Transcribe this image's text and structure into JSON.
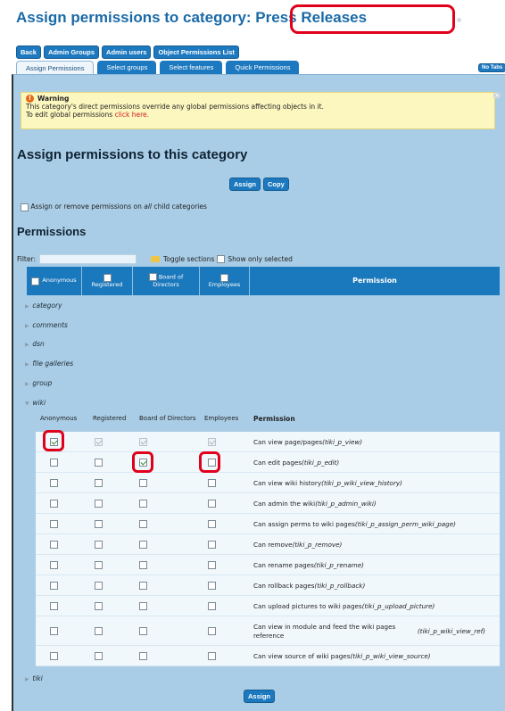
{
  "page": {
    "title_prefix": "Assign permissions to category",
    "title_category": ": Press Releases"
  },
  "nav_buttons": [
    "Back",
    "Admin Groups",
    "Admin users",
    "Object Permissions List"
  ],
  "tabs": [
    "Assign Permissions",
    "Select groups",
    "Select features",
    "Quick Permissions"
  ],
  "no_tabs_label": "No Tabs",
  "warning": {
    "heading": "Warning",
    "line1": "This category's direct permissions override any global permissions affecting objects in it.",
    "line2_prefix": "To edit global permissions",
    "link_text": "click here."
  },
  "section_heading": "Assign permissions to this category",
  "buttons": {
    "assign": "Assign",
    "copy": "Copy"
  },
  "child_categories": {
    "prefix": "Assign or remove permissions on",
    "emphasis": "all",
    "suffix": "child categories"
  },
  "permissions_heading": "Permissions",
  "filter": {
    "label": "Filter:",
    "toggle_sections": "Toggle sections",
    "show_only_selected": "Show only selected"
  },
  "group_header": [
    {
      "line1": "Anonymous",
      "line2": ""
    },
    {
      "line1": "",
      "line2": "Registered"
    },
    {
      "line1": "Board of",
      "line2": "Directors"
    },
    {
      "line1": "",
      "line2": "Employees"
    }
  ],
  "permission_header": "Permission",
  "sections": [
    "category",
    "comments",
    "dsn",
    "file galleries",
    "group",
    "wiki",
    "tiki"
  ],
  "wiki_columns": [
    "Anonymous",
    "Registered",
    "Board of Directors",
    "Employees",
    "Permission"
  ],
  "wiki_permissions": [
    {
      "label": "Can view page/pages",
      "code": "(tiki_p_view)",
      "checked": [
        true,
        true,
        true,
        true
      ],
      "disabled": [
        false,
        true,
        true,
        true
      ]
    },
    {
      "label": "Can edit pages",
      "code": "(tiki_p_edit)",
      "checked": [
        false,
        false,
        true,
        false
      ],
      "disabled": [
        false,
        false,
        false,
        false
      ]
    },
    {
      "label": "Can view wiki history",
      "code": "(tiki_p_wiki_view_history)",
      "checked": [
        false,
        false,
        false,
        false
      ],
      "disabled": [
        false,
        false,
        false,
        false
      ]
    },
    {
      "label": "Can admin the wiki",
      "code": "(tiki_p_admin_wiki)",
      "checked": [
        false,
        false,
        false,
        false
      ],
      "disabled": [
        false,
        false,
        false,
        false
      ]
    },
    {
      "label": "Can assign perms to wiki pages",
      "code": "(tiki_p_assign_perm_wiki_page)",
      "checked": [
        false,
        false,
        false,
        false
      ],
      "disabled": [
        false,
        false,
        false,
        false
      ]
    },
    {
      "label": "Can remove",
      "code": "(tiki_p_remove)",
      "checked": [
        false,
        false,
        false,
        false
      ],
      "disabled": [
        false,
        false,
        false,
        false
      ]
    },
    {
      "label": "Can rename pages",
      "code": "(tiki_p_rename)",
      "checked": [
        false,
        false,
        false,
        false
      ],
      "disabled": [
        false,
        false,
        false,
        false
      ]
    },
    {
      "label": "Can rollback pages",
      "code": "(tiki_p_rollback)",
      "checked": [
        false,
        false,
        false,
        false
      ],
      "disabled": [
        false,
        false,
        false,
        false
      ]
    },
    {
      "label": "Can upload pictures to wiki pages",
      "code": "(tiki_p_upload_picture)",
      "checked": [
        false,
        false,
        false,
        false
      ],
      "disabled": [
        false,
        false,
        false,
        false
      ]
    },
    {
      "label": "Can view in module and feed the wiki pages reference",
      "code": "(tiki_p_wiki_view_ref)",
      "checked": [
        false,
        false,
        false,
        false
      ],
      "disabled": [
        false,
        false,
        false,
        false
      ]
    },
    {
      "label": "Can view source of wiki pages",
      "code": "(tiki_p_wiki_view_source)",
      "checked": [
        false,
        false,
        false,
        false
      ],
      "disabled": [
        false,
        false,
        false,
        false
      ]
    }
  ]
}
